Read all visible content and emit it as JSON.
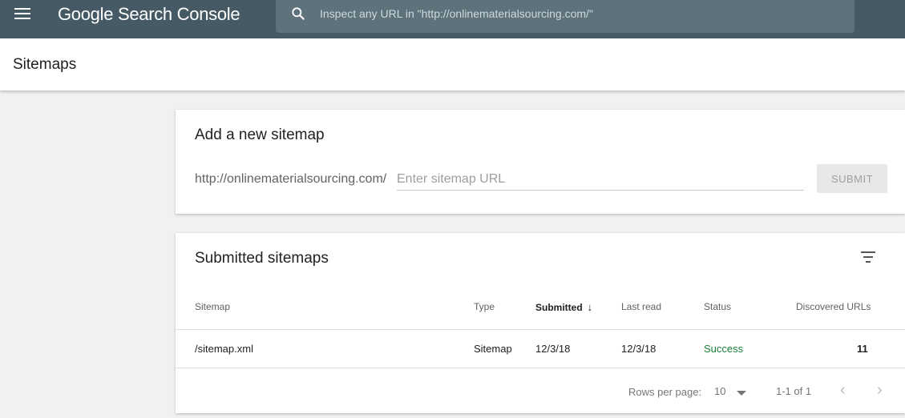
{
  "app": {
    "title": "Google Search Console"
  },
  "search": {
    "placeholder": "Inspect any URL in \"http://onlinematerialsourcing.com/\""
  },
  "page": {
    "title": "Sitemaps"
  },
  "add_sitemap": {
    "title": "Add a new sitemap",
    "url_prefix": "http://onlinematerialsourcing.com/",
    "input_placeholder": "Enter sitemap URL",
    "submit_label": "SUBMIT"
  },
  "submitted": {
    "title": "Submitted sitemaps",
    "columns": {
      "sitemap": "Sitemap",
      "type": "Type",
      "submitted": "Submitted",
      "last_read": "Last read",
      "status": "Status",
      "discovered": "Discovered URLs"
    },
    "rows": [
      {
        "sitemap": "/sitemap.xml",
        "type": "Sitemap",
        "submitted": "12/3/18",
        "last_read": "12/3/18",
        "status": "Success",
        "discovered": "11"
      }
    ],
    "footer": {
      "rows_per_page_label": "Rows per page:",
      "rows_per_page_value": "10",
      "range": "1-1 of 1"
    }
  },
  "colors": {
    "topbar": "#455a64",
    "search_box": "#5e727c",
    "status_success": "#188038"
  },
  "icons": {
    "menu": "hamburger-menu-icon",
    "search": "magnifier-icon",
    "filter": "filter-icon",
    "sort": "arrow-down-icon",
    "dropdown": "caret-down-icon",
    "prev": "chevron-left-icon",
    "next": "chevron-right-icon"
  }
}
